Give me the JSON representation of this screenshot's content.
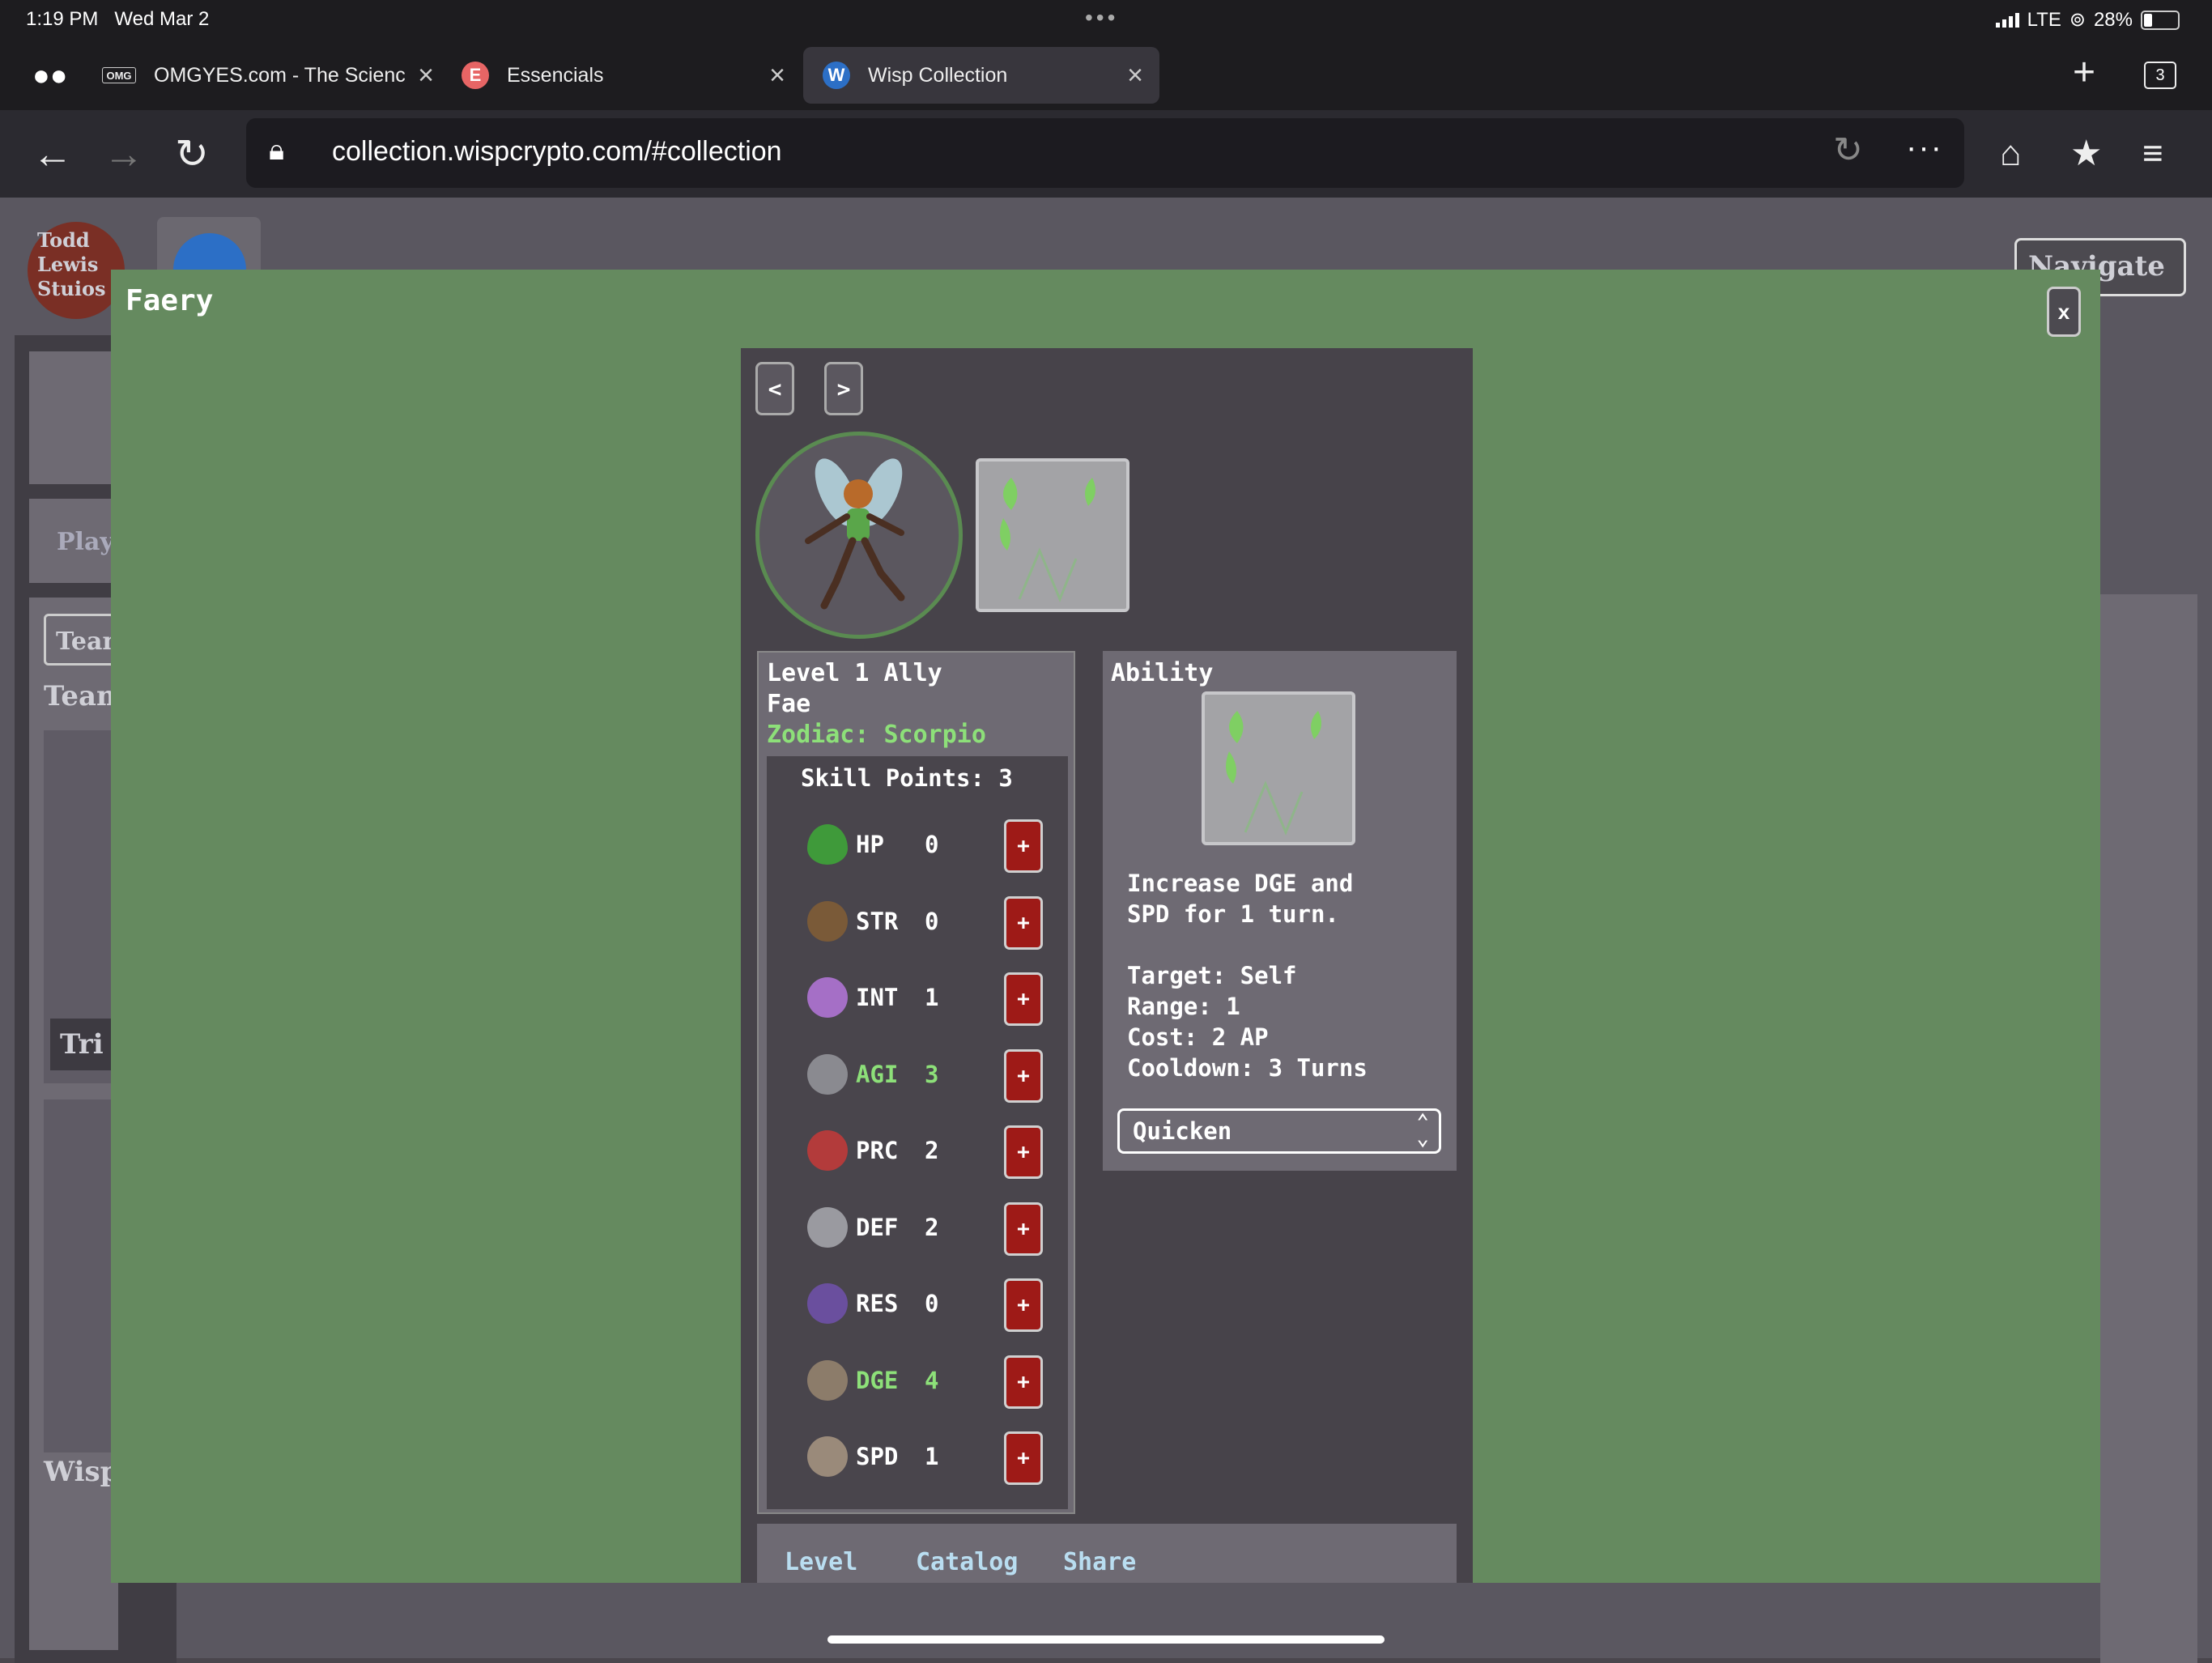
{
  "status": {
    "time": "1:19 PM",
    "date": "Wed Mar 2",
    "network": "LTE",
    "battery": "28%"
  },
  "browser": {
    "tabs": [
      {
        "label": "OMGYES.com - The Science",
        "icon_text": "OMG"
      },
      {
        "label": "Essencials",
        "icon_text": "E"
      },
      {
        "label": "Wisp Collection",
        "icon_text": "W"
      }
    ],
    "tab_count": "3",
    "url": "collection.wispcrypto.com/#collection"
  },
  "background_page": {
    "studio": "Todd\nLewis\nStuios",
    "navigate": "Navigate",
    "play": "Play",
    "team_button": "Team",
    "team_heading": "Team",
    "tri": "Tri",
    "wisp": "Wisp"
  },
  "modal": {
    "title": "Faery",
    "close_label": "x",
    "prev_label": "<",
    "next_label": ">",
    "level_line": "Level 1 Ally",
    "type_line": "Fae",
    "zodiac_line": "Zodiac: Scorpio",
    "skill_points": "Skill Points: 3",
    "plus_label": "+",
    "stats": [
      {
        "name": "HP",
        "value": "0",
        "icon": "hp-drop-icon",
        "bonus": false
      },
      {
        "name": "STR",
        "value": "0",
        "icon": "str-arm-icon",
        "bonus": false
      },
      {
        "name": "INT",
        "value": "1",
        "icon": "int-brain-icon",
        "bonus": false
      },
      {
        "name": "AGI",
        "value": "3",
        "icon": "agi-bird-icon",
        "bonus": true
      },
      {
        "name": "PRC",
        "value": "2",
        "icon": "prc-crosshair-icon",
        "bonus": false
      },
      {
        "name": "DEF",
        "value": "2",
        "icon": "def-shield-icon",
        "bonus": false
      },
      {
        "name": "RES",
        "value": "0",
        "icon": "res-orb-icon",
        "bonus": false
      },
      {
        "name": "DGE",
        "value": "4",
        "icon": "dge-figure-icon",
        "bonus": true
      },
      {
        "name": "SPD",
        "value": "1",
        "icon": "spd-boot-icon",
        "bonus": false
      }
    ],
    "ability": {
      "title": "Ability",
      "desc_line1": "Increase DGE and",
      "desc_line2": "SPD for 1 turn.",
      "target": "Target: Self",
      "range": "Range: 1",
      "cost": "Cost: 2 AP",
      "cooldown": "Cooldown: 3 Turns",
      "selected": "Quicken"
    },
    "bottom_tabs": [
      "Level",
      "Catalog",
      "Share"
    ]
  },
  "colors": {
    "modal_bg": "#658a5f",
    "panel_bg": "#47434a",
    "plus_bg": "#9e1a17",
    "bonus_text": "#8de079",
    "tab_link": "#b9ddf0"
  }
}
